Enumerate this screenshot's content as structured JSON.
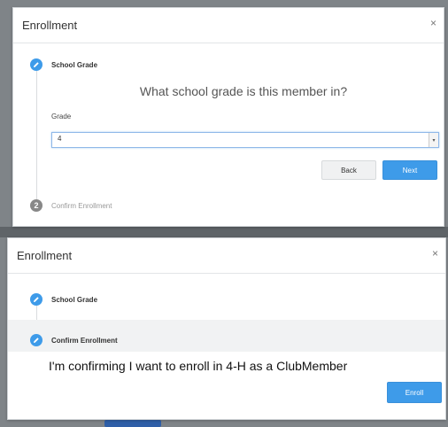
{
  "modal_top": {
    "title": "Enrollment",
    "close": "×",
    "step1": "School Grade",
    "question": "What school grade is this member in?",
    "field_label": "Grade",
    "select_value": "4",
    "back_label": "Back",
    "next_label": "Next",
    "step2_number": "2",
    "step2": "Confirm Enrollment"
  },
  "modal_bottom": {
    "title": "Enrollment",
    "close": "×",
    "step1": "School Grade",
    "step2": "Confirm Enrollment",
    "confirm_text": "I'm confirming I want to enroll in 4-H as a ClubMember",
    "enroll_label": "Enroll"
  },
  "colors": {
    "accent": "#3e9be9",
    "backdrop": "#7f8488"
  },
  "icons": {
    "step_complete": "pencil-icon",
    "step_pending": "number-badge"
  }
}
